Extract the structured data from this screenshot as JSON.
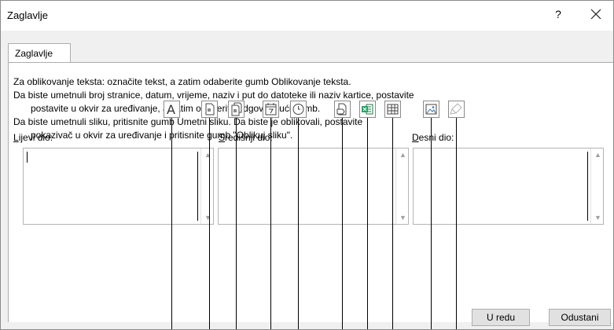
{
  "dialog": {
    "title": "Zaglavlje",
    "help_label": "?",
    "close_label": "X"
  },
  "tab": {
    "label": "Zaglavlje"
  },
  "instructions": [
    "Za oblikovanje teksta: označite tekst, a zatim odaberite gumb Oblikovanje teksta.",
    "Da biste umetnuli broj stranice, datum, vrijeme, naziv i put do datoteke ili naziv kartice, postavite",
    "postavite u okvir za uređivanje, a zatim odaberite odgovarajući gumb.",
    "Da biste umetnuli sliku, pritisnite gumb Umetni sliku.  Da biste je oblikovali, postavite",
    "pokazivač u okvir za uređivanje i pritisnite gumb \"Oblikuj sliku\"."
  ],
  "toolbar": {
    "format_text_letter": "A",
    "buttons": [
      "format-text",
      "page-number",
      "number-of-pages",
      "date",
      "time",
      "file-path",
      "file-name",
      "sheet-name",
      "insert-picture",
      "format-picture"
    ]
  },
  "sections": {
    "left": {
      "label_key": "L",
      "label_rest": "ijevi dio:",
      "value": ""
    },
    "center": {
      "label_key": "S",
      "label_rest": "redišnji dio:",
      "value": ""
    },
    "right": {
      "label_key": "D",
      "label_rest": "esni dio:",
      "value": ""
    }
  },
  "buttons": {
    "ok": "U redu",
    "cancel": "Odustani"
  },
  "colors": {
    "excel_green": "#21a366",
    "dialog_bg": "#f0f0f0",
    "panel_bg": "#ffffff"
  }
}
